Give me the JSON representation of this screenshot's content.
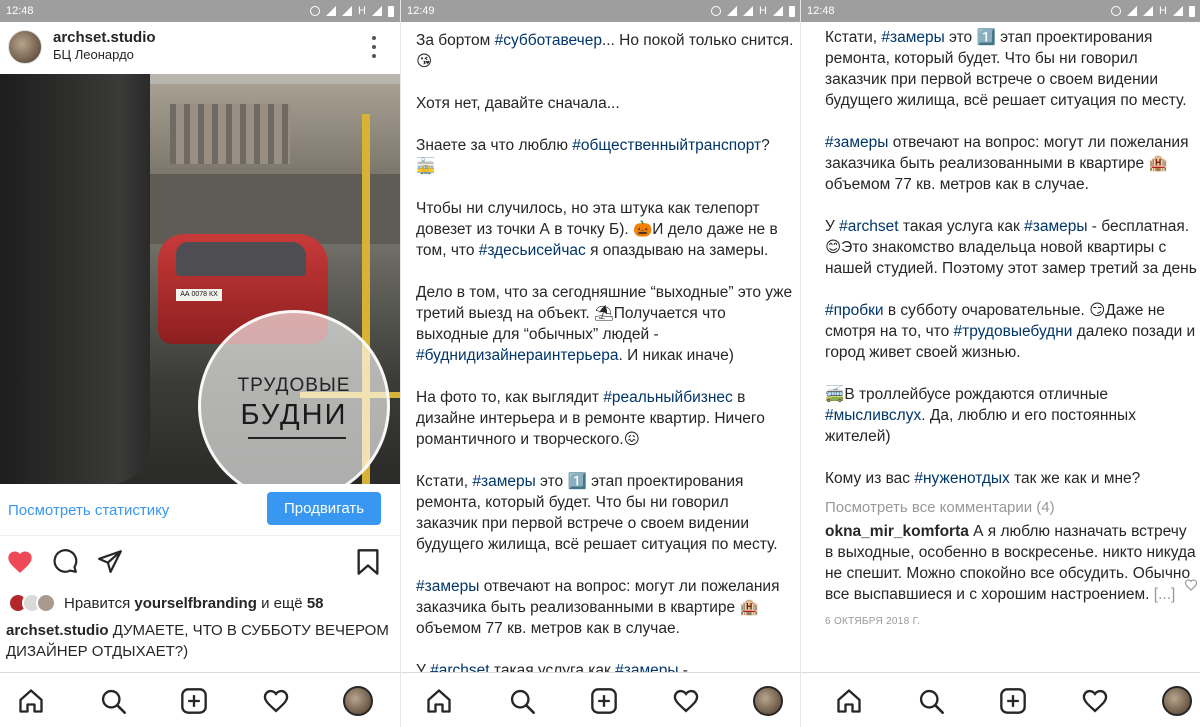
{
  "status_bar": {
    "time": "12:48",
    "time2": "12:49",
    "time3": "12:48",
    "net": "H"
  },
  "post": {
    "username": "archset.studio",
    "location": "БЦ Леонардо",
    "image": {
      "line1": "ТРУДОВЫЕ",
      "line2": "БУДНИ",
      "plate": "АА 0078 КХ"
    },
    "stats_link": "Посмотреть статистику",
    "promote_label": "Продвигать",
    "likes": {
      "prefix": "Нравится",
      "user": "yourselfbranding",
      "middle": "и ещё",
      "count": "58"
    },
    "caption_user": "archset.studio",
    "caption_text": "ДУМАЕТЕ, ЧТО В СУББОТУ ВЕЧЕРОМ ДИЗАЙНЕР ОТДЫХАЕТ?)"
  },
  "icons": {
    "nav": [
      "home-icon",
      "search-icon",
      "add-post-icon",
      "activity-heart-icon",
      "profile-avatar"
    ],
    "actions": [
      "like-heart-icon",
      "comment-icon",
      "share-icon",
      "save-bookmark-icon"
    ],
    "like_color": "#ed4956",
    "accent": "#3897f0",
    "hashtag_color": "#003569"
  },
  "panel2": {
    "p1a": "За бортом ",
    "t1": "#субботавечер",
    "p1b": "... Но покой только снится.",
    "p2": "Хотя нет, давайте сначала...",
    "p3a": "Знаете за что люблю ",
    "t3": "#общественныйтранспорт",
    "p3b": "?",
    "p4a": "Чтобы ни случилось, но эта штука как телепорт довезет из точки А в точку Б). ",
    "p4b": "И дело даже не в том, что ",
    "t4": "#здесьисейчас",
    "p4c": " я опаздываю на замеры.",
    "p5a": "Дело в том, что за сегодняшние “выходные” это уже третий выезд на объект. ",
    "p5b": "Получается что выходные для “обычных” людей - ",
    "t5": "#буднидизайнераинтерьера",
    "p5c": ". И никак иначе)",
    "p6a": "На фото то, как выглядит ",
    "t6": "#реальныйбизнес",
    "p6b": " в дизайне интерьера и в ремонте квартир. Ничего романтичного и творческого.",
    "p7a": "Кстати, ",
    "t7": "#замеры",
    "p7b": " это ",
    "p7c": " этап проектирования ремонта, который будет. Что бы ни говорил заказчик при первой встрече о своем видении будущего жилища, всё решает ситуация по месту.",
    "t8": "#замеры",
    "p8a": " отвечают на вопрос: могут ли пожелания заказчика быть реализованными в квартире ",
    "p8b": "объемом 77 кв. метров как в случае.",
    "p9a": "У ",
    "t9a": "#archset",
    "p9b": " такая услуга как ",
    "t9b": "#замеры",
    "p9c": " -"
  },
  "panel3": {
    "p1a": "Кстати, ",
    "t1": "#замеры",
    "p1b": " это ",
    "p1c": " этап проектирования ремонта, который будет. Что бы ни говорил заказчик при первой встрече о своем видении будущего жилища, всё решает ситуация по месту.",
    "t2": "#замеры",
    "p2a": " отвечают на вопрос: могут ли пожелания заказчика быть реализованными в квартире ",
    "p2b": "объемом 77 кв. метров как в случае.",
    "p3a": "У ",
    "t3a": "#archset",
    "p3b": " такая услуга как ",
    "t3b": "#замеры",
    "p3c": " - бесплатная. ",
    "p3d": "Это знакомство владельца новой квартиры с нашей студией. Поэтому этот замер третий за день",
    "t4": "#пробки",
    "p4a": " в субботу очаровательные. ",
    "p4b": "Даже не смотря на то, что ",
    "t4b": "#трудовыебудни",
    "p4c": " далеко позади и город живет своей жизнью.",
    "p5a": "В троллейбусе рождаются отличные ",
    "t5": "#мысливслух",
    "p5b": ". Да, люблю  и его постоянных жителей)",
    "p6a": "Кому из вас ",
    "t6": "#нуженотдых",
    "p6b": " так же как и мне?",
    "comments_link": "Посмотреть все комментарии (4)",
    "comment_user": "okna_mir_komforta",
    "comment_text": " А я люблю назначать встречу в выходные, особенно в воскресенье. никто никуда не спешит. Можно спокойно все обсудить. Обычно все выспавшиеся и с хорошим настроением. ",
    "comment_more": "[...]",
    "date": "6 ОКТЯБРЯ 2018 Г."
  }
}
